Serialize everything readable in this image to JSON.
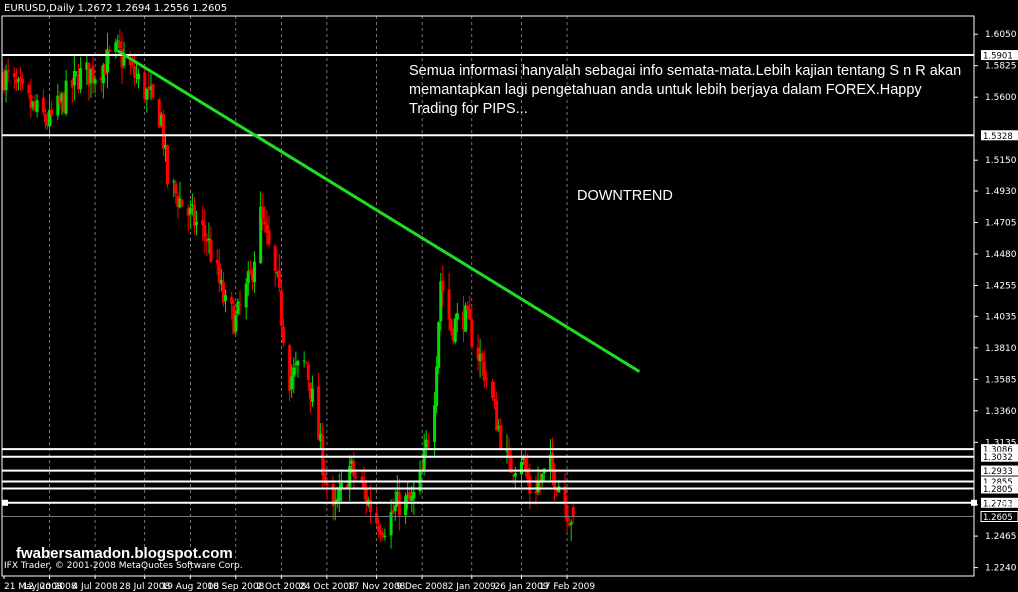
{
  "chart_data": {
    "type": "candlestick",
    "title": "EURUSD,Daily  1.2672 1.2694 1.2556 1.2605",
    "symbol": "EURUSD",
    "timeframe": "Daily",
    "last_bar": {
      "open": 1.2672,
      "high": 1.2694,
      "low": 1.2556,
      "close": 1.2605
    },
    "ylim": [
      1.218,
      1.618
    ],
    "y_ticks": [
      1.605,
      1.5825,
      1.56,
      1.515,
      1.493,
      1.4705,
      1.448,
      1.4255,
      1.4035,
      1.381,
      1.3585,
      1.336,
      1.3135,
      1.269,
      1.2465,
      1.224
    ],
    "x_ticks": [
      "21 May 2008",
      "12 Jun 2008",
      "4 Jul 2008",
      "28 Jul 2008",
      "19 Aug 2008",
      "10 Sep 2008",
      "2 Oct 2008",
      "24 Oct 2008",
      "17 Nov 2008",
      "9 Dec 2008",
      "2 Jan 2009",
      "26 Jan 2009",
      "17 Feb 2009"
    ],
    "levels": [
      {
        "value": 1.5901,
        "label": "1.5901"
      },
      {
        "value": 1.5328,
        "label": "1.5328"
      },
      {
        "value": 1.3086,
        "label": "1.3086"
      },
      {
        "value": 1.3032,
        "label": "1.3032"
      },
      {
        "value": 1.2933,
        "label": "1.2933"
      },
      {
        "value": 1.2855,
        "label": "1.2855"
      },
      {
        "value": 1.2805,
        "label": "1.2805"
      },
      {
        "value": 1.2703,
        "label": "1.2703"
      }
    ],
    "current_price": {
      "value": 1.2605,
      "label": "1.2605"
    },
    "trendline": {
      "label": "DOWNTREND",
      "from": {
        "date": "2008-07-15",
        "price": 1.593
      },
      "to": {
        "date": "2009-03-24",
        "price": 1.364
      },
      "color": "#22dd22"
    },
    "anchors": [
      [
        "2008-05-21",
        1.576
      ],
      [
        "2008-06-05",
        1.55
      ],
      [
        "2008-06-12",
        1.542
      ],
      [
        "2008-06-26",
        1.575
      ],
      [
        "2008-07-04",
        1.578
      ],
      [
        "2008-07-15",
        1.592
      ],
      [
        "2008-07-28",
        1.565
      ],
      [
        "2008-08-05",
        1.545
      ],
      [
        "2008-08-08",
        1.5
      ],
      [
        "2008-08-19",
        1.475
      ],
      [
        "2008-08-27",
        1.46
      ],
      [
        "2008-09-05",
        1.41
      ],
      [
        "2008-09-10",
        1.4
      ],
      [
        "2008-09-17",
        1.43
      ],
      [
        "2008-09-22",
        1.475
      ],
      [
        "2008-09-30",
        1.425
      ],
      [
        "2008-10-06",
        1.36
      ],
      [
        "2008-10-14",
        1.37
      ],
      [
        "2008-10-22",
        1.3
      ],
      [
        "2008-10-27",
        1.26
      ],
      [
        "2008-11-04",
        1.295
      ],
      [
        "2008-11-10",
        1.28
      ],
      [
        "2008-11-17",
        1.258
      ],
      [
        "2008-11-21",
        1.255
      ],
      [
        "2008-11-28",
        1.27
      ],
      [
        "2008-12-04",
        1.27
      ],
      [
        "2008-12-09",
        1.29
      ],
      [
        "2008-12-15",
        1.35
      ],
      [
        "2008-12-18",
        1.43
      ],
      [
        "2008-12-23",
        1.395
      ],
      [
        "2008-12-29",
        1.405
      ],
      [
        "2009-01-02",
        1.39
      ],
      [
        "2009-01-08",
        1.365
      ],
      [
        "2009-01-14",
        1.33
      ],
      [
        "2009-01-20",
        1.295
      ],
      [
        "2009-01-26",
        1.305
      ],
      [
        "2009-01-30",
        1.28
      ],
      [
        "2009-02-04",
        1.285
      ],
      [
        "2009-02-09",
        1.295
      ],
      [
        "2009-02-13",
        1.285
      ],
      [
        "2009-02-18",
        1.262
      ],
      [
        "2009-02-20",
        1.2605
      ]
    ],
    "colors": {
      "background": "#000000",
      "grid": "#ffffff",
      "bull": "#00dd00",
      "bear": "#ff0000",
      "axis": "#ffffff"
    }
  },
  "annotation_text": "Semua informasi hanyalah sebagai info semata-mata.Lebih kajian tentang S n R akan memantapkan lagi pengetahuan anda untuk lebih berjaya dalam FOREX.Happy Trading for PIPS...",
  "watermark": "fwabersamadon.blogspot.com",
  "copyright": "IFX Trader, © 2001-2008 MetaQuotes Software Corp."
}
